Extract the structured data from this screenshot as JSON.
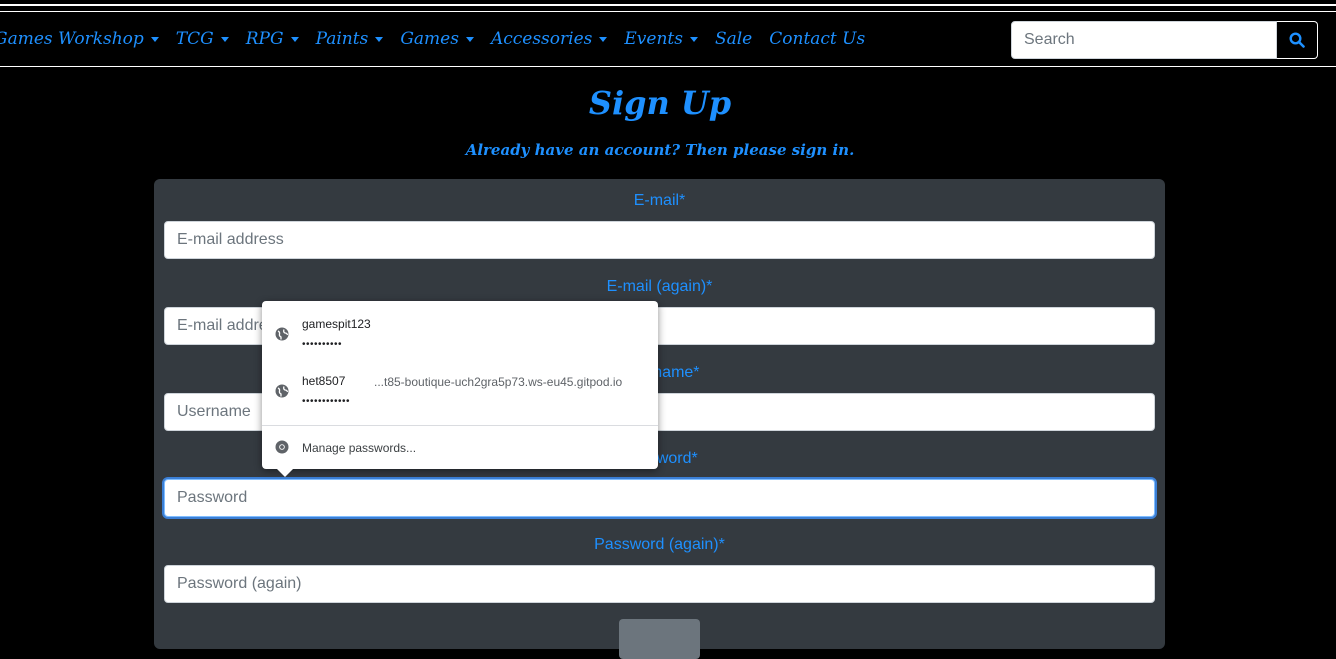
{
  "nav": {
    "items": [
      {
        "label": "Games Workshop",
        "dropdown": true
      },
      {
        "label": "TCG",
        "dropdown": true
      },
      {
        "label": "RPG",
        "dropdown": true
      },
      {
        "label": "Paints",
        "dropdown": true
      },
      {
        "label": "Games",
        "dropdown": true
      },
      {
        "label": "Accessories",
        "dropdown": true
      },
      {
        "label": "Events",
        "dropdown": true
      },
      {
        "label": "Sale",
        "dropdown": false
      },
      {
        "label": "Contact Us",
        "dropdown": false
      }
    ],
    "search_placeholder": "Search",
    "search_icon": "search-icon"
  },
  "page": {
    "title": "Sign Up",
    "signin_prompt": "Already have an account? Then please sign in."
  },
  "form": {
    "email_label": "E-mail*",
    "email_placeholder": "E-mail address",
    "email2_label": "E-mail (again)*",
    "email2_placeholder": "E-mail address",
    "username_label": "Username*",
    "username_placeholder": "Username",
    "password_label": "Password*",
    "password_placeholder": "Password",
    "password2_label": "Password (again)*",
    "password2_placeholder": "Password (again)"
  },
  "password_popup": {
    "entries": [
      {
        "username": "gamespit123",
        "masked": "••••••••••",
        "site": ""
      },
      {
        "username": "het8507",
        "masked": "••••••••••••",
        "site": "...t85-boutique-uch2gra5p73.ws-eu45.gitpod.io"
      }
    ],
    "manage_label": "Manage passwords..."
  },
  "colors": {
    "accent": "#1e90ff",
    "card": "#343a40",
    "background": "#000000"
  }
}
